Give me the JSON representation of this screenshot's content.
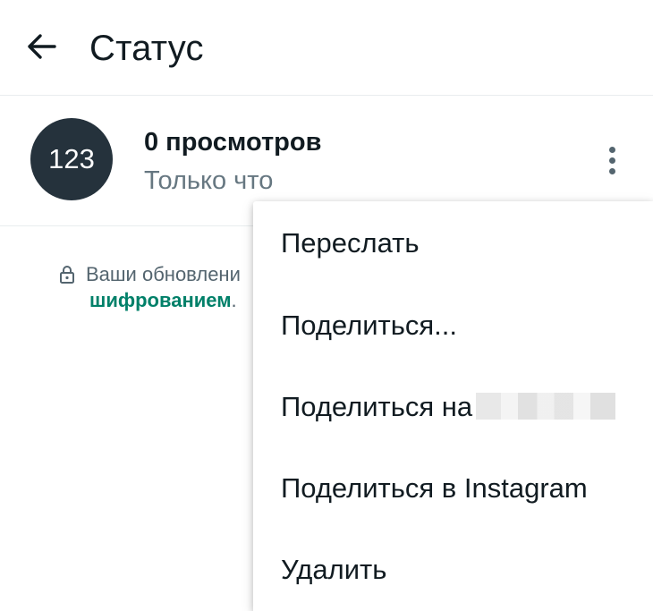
{
  "header": {
    "title": "Статус",
    "back_icon": "arrow-left-icon"
  },
  "status": {
    "avatar_text": "123",
    "avatar_color": "#25323c",
    "views": "0 просмотров",
    "time": "Только что",
    "more_icon": "more-vertical-icon"
  },
  "encryption_note": {
    "line1": "Ваши обновлени",
    "link": "шифрованием",
    "suffix": ".",
    "lock_icon": "lock-icon",
    "link_color": "#008069"
  },
  "menu": {
    "items": [
      {
        "label": "Переслать"
      },
      {
        "label": "Поделиться..."
      },
      {
        "label": "Поделиться на"
      },
      {
        "label": "Поделиться в Instagram"
      },
      {
        "label": "Удалить"
      }
    ]
  }
}
